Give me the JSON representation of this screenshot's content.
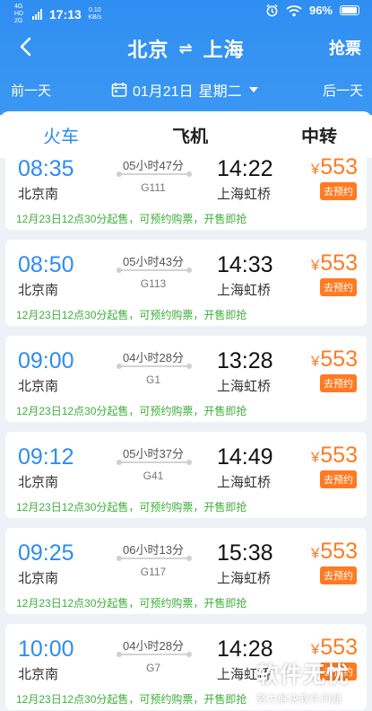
{
  "status_bar": {
    "network": "4G HD 2G",
    "time": "17:13",
    "speed": "0.10 KB/s",
    "battery": "96%"
  },
  "nav": {
    "from": "北京",
    "swap": "⇌",
    "to": "上海",
    "action": "抢票"
  },
  "date_bar": {
    "prev": "前一天",
    "date": "01月21日",
    "weekday": "星期二",
    "next": "后一天"
  },
  "tabs": [
    {
      "label": "火车",
      "active": true
    },
    {
      "label": "飞机",
      "active": false
    },
    {
      "label": "中转",
      "active": false
    }
  ],
  "trains": [
    {
      "dep_time": "08:35",
      "dep_station": "北京南",
      "duration": "05小时47分",
      "train_no": "G111",
      "arr_time": "14:22",
      "arr_station": "上海虹桥",
      "currency": "¥",
      "price": "553",
      "button": "去预约",
      "notice": "12月23日12点30分起售，可预约购票，开售即抢"
    },
    {
      "dep_time": "08:50",
      "dep_station": "北京南",
      "duration": "05小时43分",
      "train_no": "G113",
      "arr_time": "14:33",
      "arr_station": "上海虹桥",
      "currency": "¥",
      "price": "553",
      "button": "去预约",
      "notice": "12月23日12点30分起售，可预约购票，开售即抢"
    },
    {
      "dep_time": "09:00",
      "dep_station": "北京南",
      "duration": "04小时28分",
      "train_no": "G1",
      "arr_time": "13:28",
      "arr_station": "上海虹桥",
      "currency": "¥",
      "price": "553",
      "button": "去预约",
      "notice": "12月23日12点30分起售，可预约购票，开售即抢"
    },
    {
      "dep_time": "09:12",
      "dep_station": "北京南",
      "duration": "05小时37分",
      "train_no": "G41",
      "arr_time": "14:49",
      "arr_station": "上海虹桥",
      "currency": "¥",
      "price": "553",
      "button": "去预约",
      "notice": "12月23日12点30分起售，可预约购票，开售即抢"
    },
    {
      "dep_time": "09:25",
      "dep_station": "北京南",
      "duration": "06小时13分",
      "train_no": "G117",
      "arr_time": "15:38",
      "arr_station": "上海虹桥",
      "currency": "¥",
      "price": "553",
      "button": "去预约",
      "notice": "12月23日12点30分起售，可预约购票，开售即抢"
    },
    {
      "dep_time": "10:00",
      "dep_station": "北京南",
      "duration": "04小时28分",
      "train_no": "G7",
      "arr_time": "14:28",
      "arr_station": "上海虹桥",
      "currency": "¥",
      "price": "553",
      "button": "去预约",
      "notice": "12月23日12点30分起售，可预约购票，开售即抢"
    }
  ],
  "watermark": {
    "title": "软件无忧",
    "subtitle": "努力解决软件问题"
  },
  "colors": {
    "header_blue": "#2f8ef1",
    "accent_blue": "#2d8cf0",
    "price_orange": "#ff7a22",
    "notice_green": "#3fae3a"
  },
  "icons": [
    "back-arrow-icon",
    "swap-icon",
    "calendar-icon",
    "caret-down-icon",
    "wifi-icon",
    "alarm-icon",
    "battery-icon"
  ]
}
